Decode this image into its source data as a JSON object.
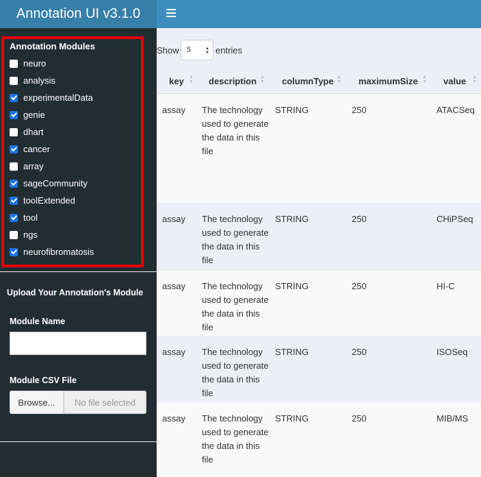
{
  "app": {
    "title": "Annotation UI v3.1.0"
  },
  "sidebar": {
    "modules_title": "Annotation Modules",
    "modules": [
      {
        "label": "neuro",
        "checked": false
      },
      {
        "label": "analysis",
        "checked": false
      },
      {
        "label": "experimentalData",
        "checked": true
      },
      {
        "label": "genie",
        "checked": true
      },
      {
        "label": "dhart",
        "checked": false
      },
      {
        "label": "cancer",
        "checked": true
      },
      {
        "label": "array",
        "checked": false
      },
      {
        "label": "sageCommunity",
        "checked": true
      },
      {
        "label": "toolExtended",
        "checked": true
      },
      {
        "label": "tool",
        "checked": true
      },
      {
        "label": "ngs",
        "checked": false
      },
      {
        "label": "neurofibromatosis",
        "checked": true
      }
    ],
    "upload_title": "Upload Your Annotation's Module",
    "module_name_label": "Module Name",
    "module_name_value": "",
    "csv_label": "Module CSV File",
    "browse_label": "Browse...",
    "file_status": "No file selected"
  },
  "table": {
    "show_label": "Show",
    "entries_label": "entries",
    "page_length": "5",
    "columns": [
      "key",
      "description",
      "columnType",
      "maximumSize",
      "value"
    ],
    "rows": [
      {
        "key": "assay",
        "description": "The technology used to generate the data in this file",
        "columnType": "STRING",
        "maximumSize": "250",
        "value": "ATACSeq"
      },
      {
        "key": "assay",
        "description": "The technology used to generate the data in this file",
        "columnType": "STRING",
        "maximumSize": "250",
        "value": "CHiPSeq"
      },
      {
        "key": "assay",
        "description": "The technology used to generate the data in this file",
        "columnType": "STRING",
        "maximumSize": "250",
        "value": "HI-C"
      },
      {
        "key": "assay",
        "description": "The technology used to generate the data in this file",
        "columnType": "STRING",
        "maximumSize": "250",
        "value": "ISOSeq"
      },
      {
        "key": "assay",
        "description": "The technology used to generate the data in this file",
        "columnType": "STRING",
        "maximumSize": "250",
        "value": "MIB/MS"
      }
    ]
  },
  "colors": {
    "header": "#3c8dbc",
    "logo": "#367fa9",
    "sidebar": "#222d32",
    "highlight": "#e60000",
    "checkbox": "#1a73e8"
  },
  "icons": {
    "menu": "hamburger-icon",
    "sort": "sort-icon",
    "select_arrows": "up-down-arrows-icon"
  }
}
